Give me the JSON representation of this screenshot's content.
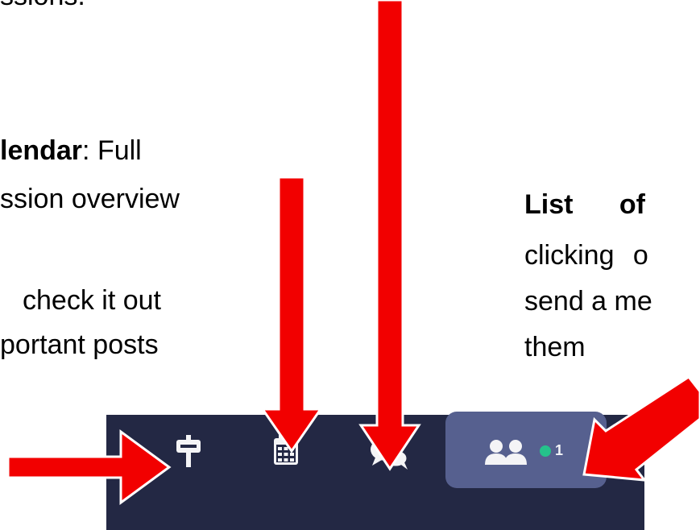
{
  "annotations": {
    "top_partial": "ssions.",
    "calendar_bold": "lendar",
    "calendar_rest": ": Full",
    "calendar_line2": "ssion overview",
    "board_line1": "check it out",
    "board_line2": "portant posts",
    "list_bold": "List of",
    "list_line2": "clicking o",
    "list_line3": "send a me",
    "list_line4": "them"
  },
  "toolbar": {
    "icons": [
      "signpost-icon",
      "calendar-icon",
      "chat-bubbles-icon",
      "people-icon"
    ],
    "online_count": "1"
  },
  "colors": {
    "toolbar_bg": "#232844",
    "people_button_bg": "#56608f",
    "online_dot": "#25c28b",
    "arrow_red": "#f20000"
  }
}
